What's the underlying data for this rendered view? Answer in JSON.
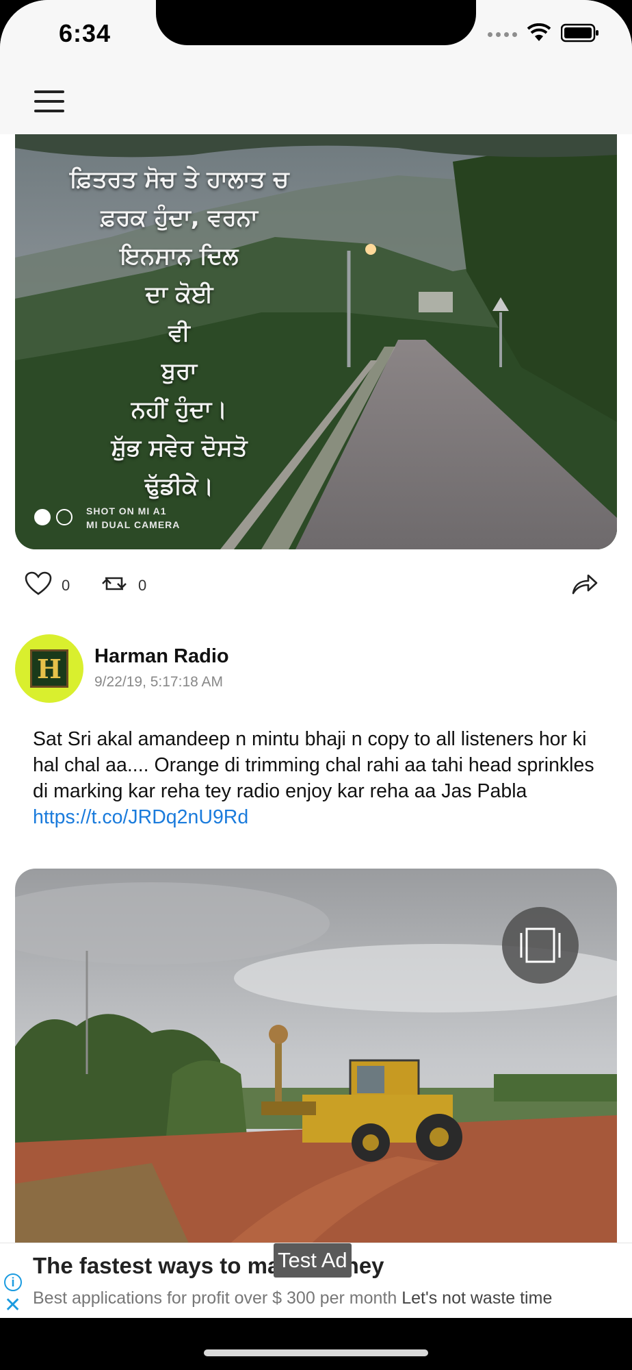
{
  "status_bar": {
    "time": "6:34"
  },
  "post1": {
    "image_caption_lines": [
      "ਫ਼ਿਤਰਤ ਸੋਚ ਤੇ ਹਾਲਾਤ ਚ",
      "ਫ਼ਰਕ ਹੁੰਦਾ, ਵਰਨਾ",
      "ਇਨਸਾਨ ਦਿਲ",
      "ਦਾ ਕੋਈ",
      "ਵੀ",
      "ਬੁਰਾ",
      "ਨਹੀਂ ਹੁੰਦਾ।",
      "ਸ਼ੁੱਭ ਸਵੇਰ ਦੋਸਤੋ",
      "ਢੁੱਡੀਕੇ।"
    ],
    "watermark_line1": "SHOT ON MI A1",
    "watermark_line2": "MI DUAL CAMERA",
    "likes": "0",
    "retweets": "0"
  },
  "post2": {
    "author": "Harman Radio",
    "avatar_letter": "H",
    "timestamp": "9/22/19, 5:17:18 AM",
    "text": "Sat Sri akal amandeep n mintu bhaji n copy to all listeners hor ki hal chal aa.... Orange di trimming chal rahi aa tahi head sprinkles di marking kar reha tey radio enjoy kar reha aa Jas Pabla ",
    "link": "https://t.co/JRDq2nU9Rd"
  },
  "ad": {
    "title": "The fastest ways to make money",
    "subtitle": "Best applications for profit over $ 300 per month ",
    "cta": "Let's not waste time",
    "badge": "Test Ad",
    "info_icon": "i",
    "close_icon": "✕"
  },
  "icons": [
    "menu-icon",
    "heart-icon",
    "retweet-icon",
    "share-icon",
    "gallery-icon",
    "info-icon",
    "close-icon"
  ]
}
